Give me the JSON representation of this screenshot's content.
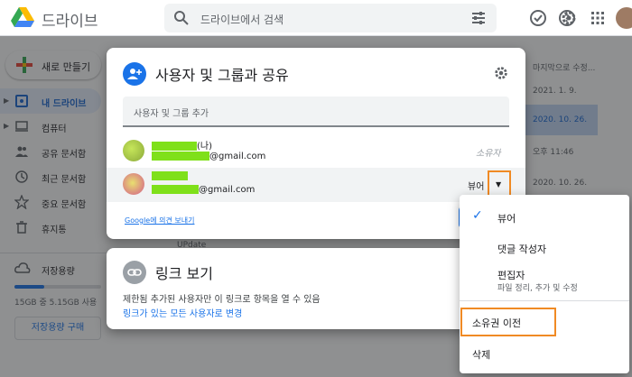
{
  "header": {
    "app_title": "드라이브",
    "search_placeholder": "드라이브에서 검색"
  },
  "sidebar": {
    "new_button": "새로 만들기",
    "items": [
      {
        "label": "내 드라이브",
        "icon": "my-drive-icon",
        "active": true
      },
      {
        "label": "컴퓨터",
        "icon": "computer-icon"
      },
      {
        "label": "공유 문서함",
        "icon": "shared-icon"
      },
      {
        "label": "최근 문서함",
        "icon": "clock-icon"
      },
      {
        "label": "중요 문서함",
        "icon": "star-icon"
      },
      {
        "label": "휴지통",
        "icon": "trash-icon"
      }
    ],
    "storage_label": "저장용량",
    "storage_text": "15GB 중 5.15GB 사용",
    "storage_fraction": 0.34,
    "buy_storage": "저장용량 구매"
  },
  "background": {
    "column_header": "마지막으로 수정...",
    "rows": [
      "2021. 1. 9.",
      "2020. 10. 26.",
      "오후 11:46",
      "2020. 10. 26."
    ],
    "partial_folder": "UPdate"
  },
  "share_dialog": {
    "title": "사용자 및 그룹과 공유",
    "add_placeholder": "사용자 및 그룹 추가",
    "people": [
      {
        "name_suffix": "(나)",
        "email_suffix": "@gmail.com",
        "role": "소유자"
      },
      {
        "email_suffix": "@gmail.com",
        "role": "뷰어"
      }
    ],
    "feedback_link": "Google에 의견 보내기"
  },
  "link_dialog": {
    "title": "링크 보기",
    "description": "제한됨 추가된 사용자만 이 링크로 항목을 열 수 있음",
    "change_link": "링크가 있는 모든 사용자로 변경"
  },
  "role_menu": {
    "items": [
      {
        "label": "뷰어",
        "checked": true
      },
      {
        "label": "댓글 작성자"
      },
      {
        "label": "편집자",
        "sub": "파일 정리, 추가 및 수정"
      },
      {
        "label": "소유권 이전"
      },
      {
        "label": "삭제"
      }
    ]
  },
  "colors": {
    "accent": "#1a73e8",
    "highlight": "#f08a24",
    "redaction": "#7fe01a"
  }
}
